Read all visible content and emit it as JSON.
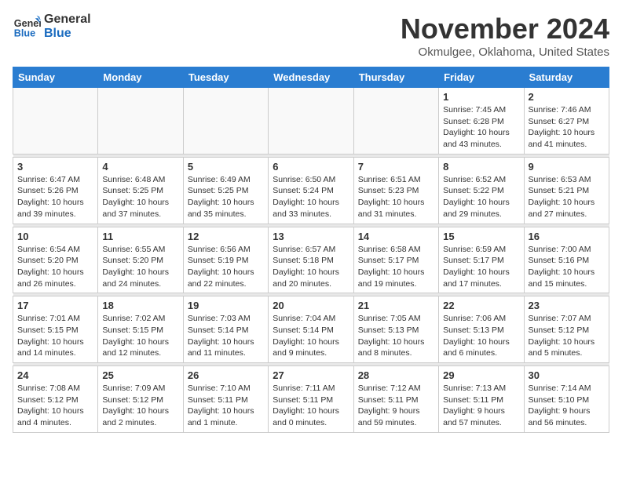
{
  "logo": {
    "line1": "General",
    "line2": "Blue"
  },
  "title": "November 2024",
  "location": "Okmulgee, Oklahoma, United States",
  "days_of_week": [
    "Sunday",
    "Monday",
    "Tuesday",
    "Wednesday",
    "Thursday",
    "Friday",
    "Saturday"
  ],
  "weeks": [
    [
      {
        "day": "",
        "info": ""
      },
      {
        "day": "",
        "info": ""
      },
      {
        "day": "",
        "info": ""
      },
      {
        "day": "",
        "info": ""
      },
      {
        "day": "",
        "info": ""
      },
      {
        "day": "1",
        "info": "Sunrise: 7:45 AM\nSunset: 6:28 PM\nDaylight: 10 hours\nand 43 minutes."
      },
      {
        "day": "2",
        "info": "Sunrise: 7:46 AM\nSunset: 6:27 PM\nDaylight: 10 hours\nand 41 minutes."
      }
    ],
    [
      {
        "day": "3",
        "info": "Sunrise: 6:47 AM\nSunset: 5:26 PM\nDaylight: 10 hours\nand 39 minutes."
      },
      {
        "day": "4",
        "info": "Sunrise: 6:48 AM\nSunset: 5:25 PM\nDaylight: 10 hours\nand 37 minutes."
      },
      {
        "day": "5",
        "info": "Sunrise: 6:49 AM\nSunset: 5:25 PM\nDaylight: 10 hours\nand 35 minutes."
      },
      {
        "day": "6",
        "info": "Sunrise: 6:50 AM\nSunset: 5:24 PM\nDaylight: 10 hours\nand 33 minutes."
      },
      {
        "day": "7",
        "info": "Sunrise: 6:51 AM\nSunset: 5:23 PM\nDaylight: 10 hours\nand 31 minutes."
      },
      {
        "day": "8",
        "info": "Sunrise: 6:52 AM\nSunset: 5:22 PM\nDaylight: 10 hours\nand 29 minutes."
      },
      {
        "day": "9",
        "info": "Sunrise: 6:53 AM\nSunset: 5:21 PM\nDaylight: 10 hours\nand 27 minutes."
      }
    ],
    [
      {
        "day": "10",
        "info": "Sunrise: 6:54 AM\nSunset: 5:20 PM\nDaylight: 10 hours\nand 26 minutes."
      },
      {
        "day": "11",
        "info": "Sunrise: 6:55 AM\nSunset: 5:20 PM\nDaylight: 10 hours\nand 24 minutes."
      },
      {
        "day": "12",
        "info": "Sunrise: 6:56 AM\nSunset: 5:19 PM\nDaylight: 10 hours\nand 22 minutes."
      },
      {
        "day": "13",
        "info": "Sunrise: 6:57 AM\nSunset: 5:18 PM\nDaylight: 10 hours\nand 20 minutes."
      },
      {
        "day": "14",
        "info": "Sunrise: 6:58 AM\nSunset: 5:17 PM\nDaylight: 10 hours\nand 19 minutes."
      },
      {
        "day": "15",
        "info": "Sunrise: 6:59 AM\nSunset: 5:17 PM\nDaylight: 10 hours\nand 17 minutes."
      },
      {
        "day": "16",
        "info": "Sunrise: 7:00 AM\nSunset: 5:16 PM\nDaylight: 10 hours\nand 15 minutes."
      }
    ],
    [
      {
        "day": "17",
        "info": "Sunrise: 7:01 AM\nSunset: 5:15 PM\nDaylight: 10 hours\nand 14 minutes."
      },
      {
        "day": "18",
        "info": "Sunrise: 7:02 AM\nSunset: 5:15 PM\nDaylight: 10 hours\nand 12 minutes."
      },
      {
        "day": "19",
        "info": "Sunrise: 7:03 AM\nSunset: 5:14 PM\nDaylight: 10 hours\nand 11 minutes."
      },
      {
        "day": "20",
        "info": "Sunrise: 7:04 AM\nSunset: 5:14 PM\nDaylight: 10 hours\nand 9 minutes."
      },
      {
        "day": "21",
        "info": "Sunrise: 7:05 AM\nSunset: 5:13 PM\nDaylight: 10 hours\nand 8 minutes."
      },
      {
        "day": "22",
        "info": "Sunrise: 7:06 AM\nSunset: 5:13 PM\nDaylight: 10 hours\nand 6 minutes."
      },
      {
        "day": "23",
        "info": "Sunrise: 7:07 AM\nSunset: 5:12 PM\nDaylight: 10 hours\nand 5 minutes."
      }
    ],
    [
      {
        "day": "24",
        "info": "Sunrise: 7:08 AM\nSunset: 5:12 PM\nDaylight: 10 hours\nand 4 minutes."
      },
      {
        "day": "25",
        "info": "Sunrise: 7:09 AM\nSunset: 5:12 PM\nDaylight: 10 hours\nand 2 minutes."
      },
      {
        "day": "26",
        "info": "Sunrise: 7:10 AM\nSunset: 5:11 PM\nDaylight: 10 hours\nand 1 minute."
      },
      {
        "day": "27",
        "info": "Sunrise: 7:11 AM\nSunset: 5:11 PM\nDaylight: 10 hours\nand 0 minutes."
      },
      {
        "day": "28",
        "info": "Sunrise: 7:12 AM\nSunset: 5:11 PM\nDaylight: 9 hours\nand 59 minutes."
      },
      {
        "day": "29",
        "info": "Sunrise: 7:13 AM\nSunset: 5:11 PM\nDaylight: 9 hours\nand 57 minutes."
      },
      {
        "day": "30",
        "info": "Sunrise: 7:14 AM\nSunset: 5:10 PM\nDaylight: 9 hours\nand 56 minutes."
      }
    ]
  ]
}
